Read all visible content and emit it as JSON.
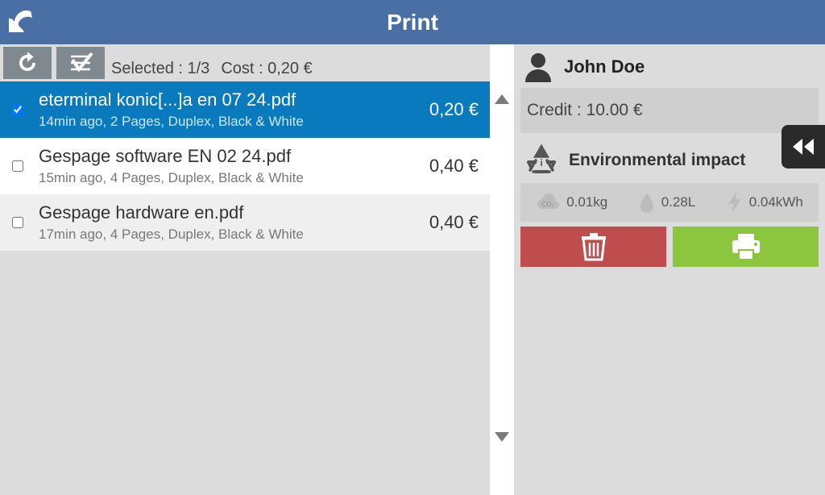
{
  "header": {
    "title": "Print"
  },
  "toolbar": {
    "selected_label": "Selected : 1/3",
    "cost_label": "Cost : 0,20 €"
  },
  "jobs": [
    {
      "selected": true,
      "title": "eterminal konic[...]a en 07 24.pdf",
      "sub": "14min ago, 2 Pages, Duplex, Black & White",
      "price": "0,20 €"
    },
    {
      "selected": false,
      "title": "Gespage software EN 02 24.pdf",
      "sub": "15min ago, 4 Pages, Duplex, Black & White",
      "price": "0,40 €"
    },
    {
      "selected": false,
      "title": "Gespage hardware en.pdf",
      "sub": "17min ago, 4 Pages, Duplex, Black & White",
      "price": "0,40 €"
    }
  ],
  "user": {
    "name": "John Doe"
  },
  "credit": {
    "label": "Credit : 10.00 €"
  },
  "env": {
    "heading": "Environmental impact",
    "co2": "0.01kg",
    "water": "0.28L",
    "energy": "0.04kWh"
  }
}
